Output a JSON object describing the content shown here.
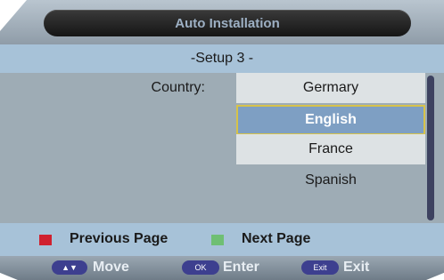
{
  "header": {
    "title": "Auto Installation"
  },
  "subtitle": "-Setup 3 -",
  "country": {
    "label": "Country:",
    "options": [
      "Germary",
      "English",
      "France",
      "Spanish"
    ],
    "selected": "English"
  },
  "legend": {
    "previous": {
      "label": "Previous Page",
      "color": "#d0202e"
    },
    "next": {
      "label": "Next Page",
      "color": "#6fbf73"
    }
  },
  "footer": {
    "move": {
      "key_icon": "up-down-arrows-icon",
      "key_text": "▲▼",
      "label": "Move"
    },
    "enter": {
      "key_text": "OK",
      "label": "Enter"
    },
    "exit": {
      "key_text": "Exit",
      "label": "Exit"
    }
  },
  "colors": {
    "selection_fill": "#7e9fc3",
    "selection_border": "#d6c24a",
    "key_pill": "#3d3f8f"
  }
}
